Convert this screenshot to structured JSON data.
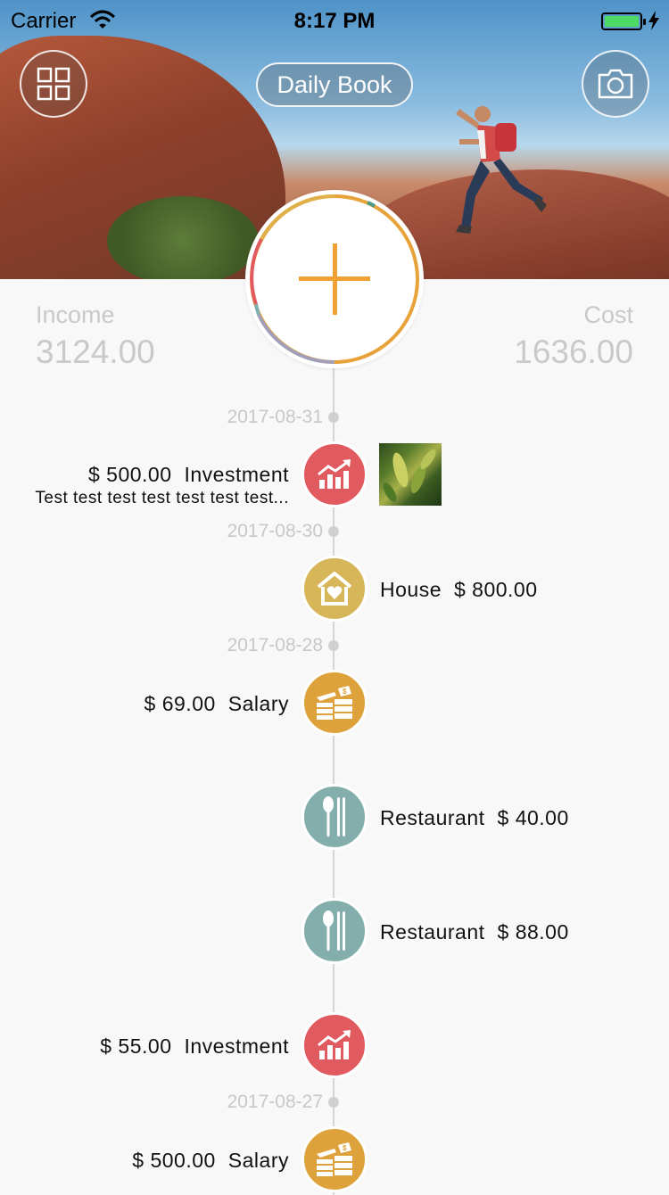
{
  "status_bar": {
    "carrier": "Carrier",
    "time": "8:17 PM"
  },
  "header": {
    "title": "Daily Book",
    "menu_icon": "grid-icon",
    "camera_icon": "camera-icon"
  },
  "summary": {
    "income_label": "Income",
    "income_value": "3124.00",
    "cost_label": "Cost",
    "cost_value": "1636.00"
  },
  "add_button_icon": "plus-icon",
  "colors": {
    "investment": "#e05a5f",
    "house": "#d6b658",
    "salary": "#dea23c",
    "restaurant": "#84aeab",
    "accent": "#f0a133"
  },
  "timeline": {
    "dates": [
      "2017-08-31",
      "2017-08-30",
      "2017-08-28",
      "2017-08-27"
    ],
    "entries": [
      {
        "amount": "$ 500.00",
        "category": "Investment",
        "note": "Test test test test test test test...",
        "icon": "chart-up-icon"
      },
      {
        "amount": "$ 800.00",
        "category": "House",
        "icon": "house-heart-icon"
      },
      {
        "amount": "$ 69.00",
        "category": "Salary",
        "icon": "money-stack-icon"
      },
      {
        "amount": "$ 40.00",
        "category": "Restaurant",
        "icon": "spoon-chopsticks-icon"
      },
      {
        "amount": "$ 88.00",
        "category": "Restaurant",
        "icon": "spoon-chopsticks-icon"
      },
      {
        "amount": "$ 55.00",
        "category": "Investment",
        "icon": "chart-up-icon"
      },
      {
        "amount": "$ 500.00",
        "category": "Salary",
        "icon": "money-stack-icon"
      }
    ]
  }
}
